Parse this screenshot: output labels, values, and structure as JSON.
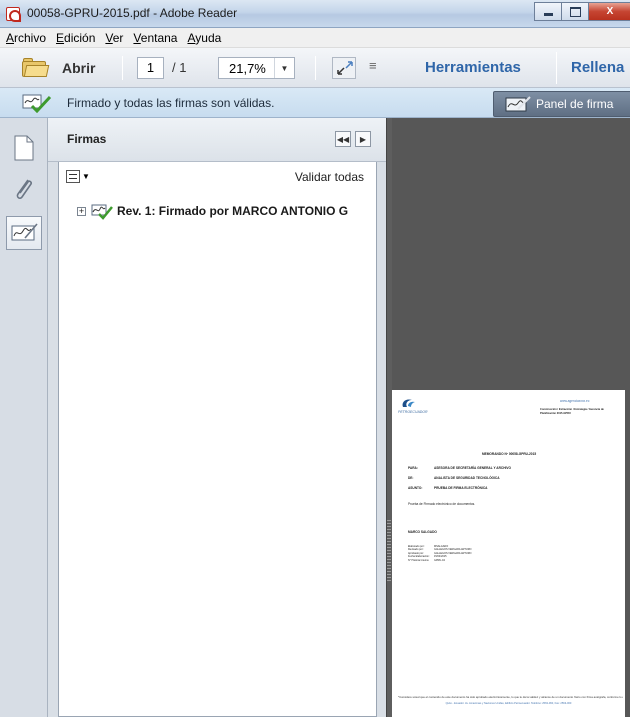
{
  "window": {
    "title": "00058-GPRU-2015.pdf - Adobe Reader",
    "buttons": {
      "minimize": "minimize",
      "maximize": "maximize",
      "close": "X"
    }
  },
  "menubar": {
    "items": [
      "Archivo",
      "Edición",
      "Ver",
      "Ventana",
      "Ayuda"
    ]
  },
  "toolbar": {
    "open_label": "Abrir",
    "page_current": "1",
    "page_total": "/ 1",
    "zoom": "21,7%",
    "tools_label": "Herramientas",
    "fill_label": "Rellena"
  },
  "signature_bar": {
    "message": "Firmado y todas las firmas son válidas.",
    "panel_button": "Panel de firma"
  },
  "signatures_panel": {
    "title": "Firmas",
    "validate_all": "Validar todas",
    "entries": [
      {
        "label": "Rev. 1: Firmado por MARCO ANTONIO G"
      }
    ]
  },
  "document_page": {
    "website": "www.agenciaxxxx.ec",
    "company": "PETROECUADOR",
    "header_right_1": "Construcción / Extracción / Estrategia / Gerencia de",
    "header_right_2": "Planificación 2015-GPRU",
    "memo_title": "MEMORANDO Nº 00058-GPRU-2015",
    "para_label": "PARA:",
    "para_value": "ASESORA DE SECRETARÍA GENERAL Y ARCHIVO",
    "de_label": "DE:",
    "de_value": "ANALISTA DE SEGURIDAD TECNOLÓGICA",
    "asunto_label": "ASUNTO:",
    "asunto_value": "PRUEBA DE FIRMA ELECTRÓNICA",
    "body": "Prueba de Firmado electrónico de documentos.",
    "signer": "MARCO SALGADO",
    "meta": [
      [
        "Elaborado por:",
        "MSALGADO"
      ],
      [
        "Revisado por:",
        "GALLEGOS VERGARA ARTURO"
      ],
      [
        "Aprobado por:",
        "GALLEGOS VERGARA ARTURO"
      ],
      [
        "Fecha Elaboración:",
        "15/04/2015"
      ],
      [
        "N° Historia Interna:",
        "GPRU-04"
      ]
    ],
    "footer": "*Considere usted que el contenido de este documento ha sido aprobado electrónicamente, lo que le da la validez y alcance de un documento físico con firma autógrafa, conforme lo establece la Ley de Comercio Electrónico, Firmas Electrónicas y Mensajes de Datos.",
    "footer_address": "Quito - Ecuador. Av. Amazonas y Naciones Unidas, Edificio Petroecuador. Teléfono: 2563-060, Fax: 2563-000"
  }
}
